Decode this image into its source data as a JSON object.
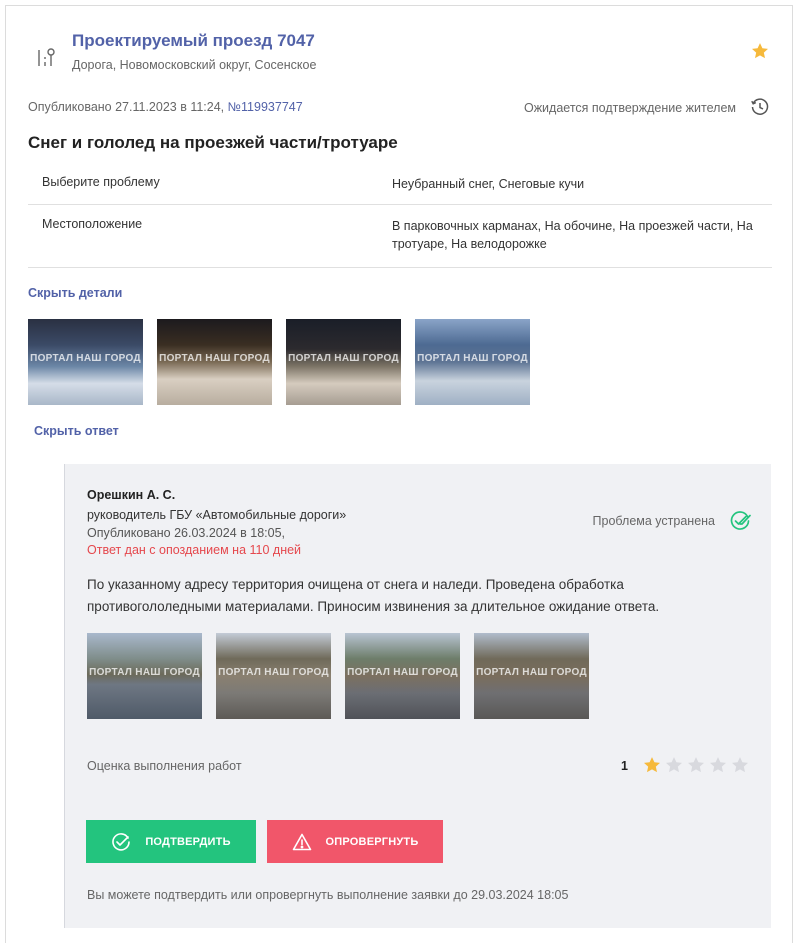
{
  "header": {
    "title": "Проектируемый проезд 7047",
    "subtitle": "Дорога, Новомосковский округ, Сосенское"
  },
  "meta": {
    "published_prefix": "Опубликовано 27.11.2023 в 11:24, ",
    "request_number": "№119937747",
    "status": "Ожидается подтверждение жителем"
  },
  "issue": {
    "title": "Снег и гололед на проезжей части/тротуаре",
    "details": [
      {
        "label": "Выберите проблему",
        "value": "Неубранный снег, Снеговые кучи"
      },
      {
        "label": "Местоположение",
        "value": "В парковочных карманах, На обочине, На проезжей части, На тротуаре, На велодорожке"
      }
    ],
    "hide_details_label": "Скрыть детали",
    "photo_watermark": "ПОРТАЛ НАШ ГОРОД"
  },
  "hide_answer_label": "Скрыть ответ",
  "answer": {
    "author": "Орешкин А. С.",
    "role": "руководитель ГБУ «Автомобильные дороги»",
    "published": "Опубликовано 26.03.2024 в 18:05,",
    "late_notice": "Ответ дан с опозданием на 110 дней",
    "status": "Проблема устранена",
    "text": "По указанному адресу территория очищена от снега и наледи. Проведена обработка противогололедными материалами. Приносим извинения за длительное ожидание ответа.",
    "rating_label": "Оценка выполнения работ",
    "rating_value": "1",
    "rating_max": 5,
    "confirm_label": "ПОДТВЕРДИТЬ",
    "reject_label": "ОПРОВЕРГНУТЬ",
    "note": "Вы можете подтвердить или опровергнуть выполнение заявки до 29.03.2024 18:05"
  },
  "colors": {
    "accent": "#5262a8",
    "star_active": "#f6b93b",
    "star_inactive": "#d8d9de",
    "confirm": "#23c47e",
    "reject": "#f1566a",
    "late": "#e5484d"
  }
}
